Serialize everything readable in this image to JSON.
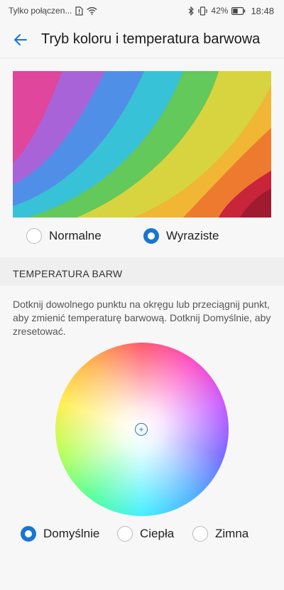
{
  "status_bar": {
    "carrier": "Tylko połączen...",
    "battery": "42%",
    "time": "18:48"
  },
  "header": {
    "title": "Tryb koloru i temperatura barwowa",
    "back_icon": "arrow-left-icon"
  },
  "color_mode": {
    "options": [
      {
        "label": "Normalne",
        "selected": false
      },
      {
        "label": "Wyraziste",
        "selected": true
      }
    ]
  },
  "temperature": {
    "section_title": "TEMPERATURA BARW",
    "description": "Dotknij dowolnego punktu na okręgu lub przeciągnij punkt, aby zmienić temperaturę barwową. Dotknij Domyślnie, aby zresetować.",
    "marker_symbol": "+",
    "options": [
      {
        "label": "Domyślnie",
        "selected": true
      },
      {
        "label": "Ciepła",
        "selected": false
      },
      {
        "label": "Zimna",
        "selected": false
      }
    ]
  },
  "colors": {
    "accent": "#1976d2",
    "background": "#f7f7f7",
    "section_background": "#efefef"
  }
}
